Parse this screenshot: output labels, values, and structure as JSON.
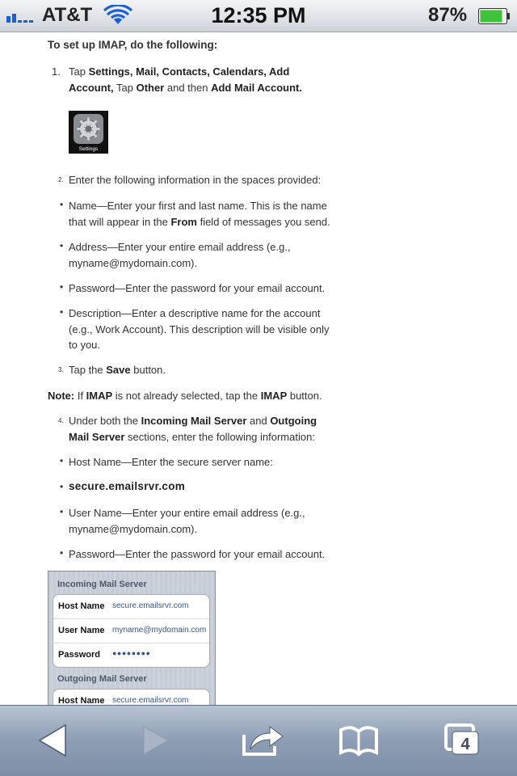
{
  "status_bar": {
    "carrier": "AT&T",
    "time": "12:35 PM",
    "battery_percent": "87",
    "battery_percent_suffix": "%",
    "battery_level": 0.87,
    "signal_bars": 2
  },
  "article": {
    "intro": "To set up IMAP, do the following:",
    "step1": {
      "number": "1.",
      "parts": [
        {
          "t": "Tap ",
          "b": false
        },
        {
          "t": "Settings, Mail, Contacts, Calendars, Add Account,",
          "b": true
        },
        {
          "t": " Tap ",
          "b": false
        },
        {
          "t": "Other",
          "b": true
        },
        {
          "t": " and then ",
          "b": false
        },
        {
          "t": "Add Mail Account",
          "b": true
        },
        {
          "t": ".",
          "b": true
        }
      ]
    },
    "settings_icon_label": "Settings",
    "step2": {
      "number": "2.",
      "text": "Enter the following information in the spaces provided:"
    },
    "bullets_a": [
      {
        "parts": [
          {
            "t": "Name—Enter your first and last name. This is the name that will appear in the ",
            "b": false
          },
          {
            "t": "From",
            "b": true
          },
          {
            "t": " field of messages you send.",
            "b": false
          }
        ]
      },
      {
        "parts": [
          {
            "t": "Address—Enter your entire email address (e.g., myname@mydomain.com).",
            "b": false
          }
        ]
      },
      {
        "parts": [
          {
            "t": "Password—Enter the password for your email account.",
            "b": false
          }
        ]
      },
      {
        "parts": [
          {
            "t": "Description—Enter a descriptive name for the account (e.g., Work Account). This description will be visible only to you.",
            "b": false
          }
        ]
      }
    ],
    "step3": {
      "number": "3.",
      "parts": [
        {
          "t": "Tap the ",
          "b": false
        },
        {
          "t": "Save",
          "b": true
        },
        {
          "t": " button.",
          "b": false
        }
      ]
    },
    "note": {
      "parts": [
        {
          "t": "Note:",
          "b": true
        },
        {
          "t": " If ",
          "b": false
        },
        {
          "t": "IMAP",
          "b": true
        },
        {
          "t": " is not already selected, tap the ",
          "b": false
        },
        {
          "t": "IMAP",
          "b": true
        },
        {
          "t": " button.",
          "b": false
        }
      ]
    },
    "step4": {
      "number": "4.",
      "parts": [
        {
          "t": "Under both the ",
          "b": false
        },
        {
          "t": "Incoming Mail Server",
          "b": true
        },
        {
          "t": " and ",
          "b": false
        },
        {
          "t": "Outgoing Mail Server",
          "b": true
        },
        {
          "t": " sections, enter the following information:",
          "b": false
        }
      ]
    },
    "bullet_host": "Host Name—Enter the secure server name:",
    "server_name": "secure.emailsrvr.com",
    "bullet_user": "User Name—Enter your entire email address (e.g., myname@mydomain.com).",
    "bullet_password": "Password—Enter the password for your email account."
  },
  "mail_panel": {
    "incoming_title": "Incoming Mail Server",
    "incoming_rows": [
      {
        "label": "Host Name",
        "value": "secure.emailsrvr.com"
      },
      {
        "label": "User Name",
        "value": "myname@mydomain.com"
      },
      {
        "label": "Password",
        "value": "●●●●●●●●"
      }
    ],
    "outgoing_title": "Outgoing Mail Server",
    "outgoing_rows": [
      {
        "label": "Host Name",
        "value": "secure.emailsrvr.com"
      }
    ]
  },
  "toolbar": {
    "tabs_count": "4",
    "icons": [
      "back-arrow-icon",
      "forward-arrow-icon",
      "share-icon",
      "bookmarks-icon",
      "tabs-icon"
    ]
  }
}
